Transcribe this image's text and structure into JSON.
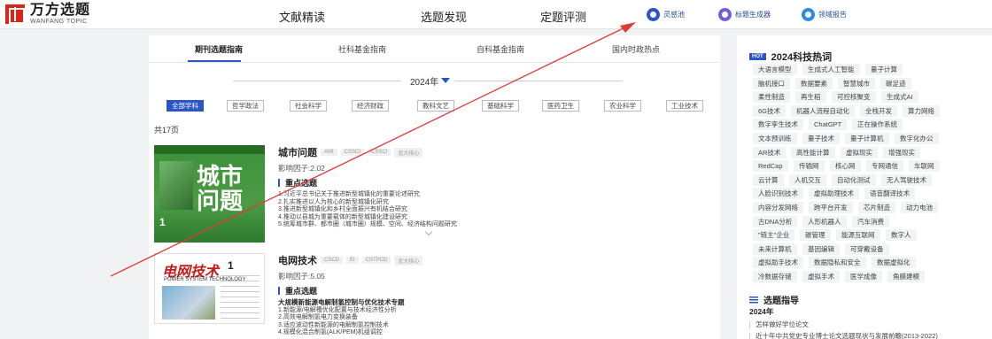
{
  "header": {
    "logo_cn": "万方选题",
    "logo_en": "WANFANG TOPIC",
    "nav": [
      "文献精读",
      "选题发现",
      "定题评测"
    ],
    "pills": [
      {
        "label": "灵感池",
        "icon": "bulb-icon",
        "color": "#2b55c4"
      },
      {
        "label": "标题生成器",
        "icon": "title-generator-icon",
        "color": "#7a5cd6"
      },
      {
        "label": "领域报告",
        "icon": "report-icon",
        "color": "#2b8be0"
      }
    ]
  },
  "main": {
    "tabs": [
      "期刊选题指南",
      "社科基金指南",
      "自科基金指南",
      "国内时政热点"
    ],
    "year": "2024年",
    "subjects": [
      "全部学科",
      "哲学政法",
      "社会科学",
      "经济财政",
      "教科文艺",
      "基础科学",
      "医药卫生",
      "农业科学",
      "工业技术"
    ],
    "pages_label": "共17页",
    "journals": [
      {
        "name": "城市问题",
        "tags": [
          "AMI",
          "CSSCI",
          "CSSCI",
          "北大核心"
        ],
        "impact": "影响因子:2.02",
        "section": "重点选题",
        "cover_title": "城市问题",
        "cover_num": "1",
        "items": [
          "1.习近平总书记关于推进新型城镇化的重要论述研究",
          "2.扎实推进以人为核心的新型城镇化研究",
          "3.推进新型城镇化和乡村全面振兴有机结合研究",
          "4.推动以县城为重要载体的新型城镇化建设研究",
          "5.统筹城市群、都市圈（城市圈）规模、空间、经济结构问题研究"
        ]
      },
      {
        "name": "电网技术",
        "tags": [
          "CSCD",
          "EI",
          "CSTPCD",
          "北大核心"
        ],
        "impact": "影响因子:5.05",
        "section": "重点选题",
        "cover_title": "电网技术",
        "cover_sub": "POWER SYSTEM TECHNOLOGY",
        "cover_num": "1",
        "items": [
          "大规模新能源电解制氢控制与优化技术专题",
          "1.新能源/电解槽优化配置与技术经济性分析",
          "2.高效电解制氢电力变换装备",
          "3.适应波动性新能源的电解制氢控制技术",
          "4.规模化混合制氢(ALK/PEM)机组调控"
        ]
      }
    ]
  },
  "side": {
    "hot_badge": "HOT",
    "title": "2024科技热词",
    "keywords": [
      [
        "大语言模型",
        "生成式人工智能",
        "量子计算"
      ],
      [
        "脑机接口",
        "数据要素",
        "智慧城市",
        "碳足迹"
      ],
      [
        "柔性制造",
        "再生稻",
        "可控核聚变",
        "生成式AI"
      ],
      [
        "6G技术",
        "机器人流程自动化",
        "全栈开发",
        "算力网络"
      ],
      [
        "数字孪生技术",
        "ChatGPT",
        "正在操作系统"
      ],
      [
        "文本预训练",
        "量子技术",
        "量子计算机",
        "数字化办公"
      ],
      [
        "AR技术",
        "高性能计算",
        "虚拟现实",
        "增强现实"
      ],
      [
        "RedCap",
        "传输网",
        "核心网",
        "专网通信",
        "车联网"
      ],
      [
        "云计算",
        "人机交互",
        "自动化测试",
        "无人驾驶技术"
      ],
      [
        "人脸识别技术",
        "虚拟助理技术",
        "语音翻译技术"
      ],
      [
        "内容分发网络",
        "跨平台开发",
        "芯片制造",
        "动力电池"
      ],
      [
        "古DNA分析",
        "人形机器人",
        "汽车消费"
      ],
      [
        "\"链主\"企业",
        "碳管理",
        "能源互联网",
        "数字人"
      ],
      [
        "未来计算机",
        "基因编辑",
        "可穿戴设备"
      ],
      [
        "虚拟助手技术",
        "数据隐私和安全",
        "数据虚拟化"
      ],
      [
        "冷数据存储",
        "虚拟手术",
        "医学成像",
        "角膜建模"
      ]
    ],
    "guide_title": "选题指导",
    "guide_year": "2024年",
    "guide_items": [
      "怎样做好学位论文",
      "近十年中共党史专业博士论文选题现状与发展前瞻(2013-2022)"
    ]
  }
}
